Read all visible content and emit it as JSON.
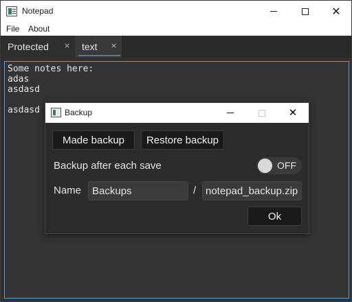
{
  "window": {
    "title": "Notepad"
  },
  "menu": {
    "file": "File",
    "about": "About"
  },
  "tabs": [
    {
      "label": "Protected",
      "close": "×"
    },
    {
      "label": "text",
      "close": "×"
    }
  ],
  "editor": {
    "content": "Some notes here:\nadas\nasdasd\n\nasdasd"
  },
  "dialog": {
    "title": "Backup",
    "made_backup": "Made backup",
    "restore_backup": "Restore backup",
    "backup_after_save_label": "Backup after each save",
    "toggle_state": "OFF",
    "name_label": "Name",
    "name_value": "Backups",
    "separator": "/",
    "file_value": "notepad_backup.zip",
    "ok": "Ok"
  },
  "icons": {
    "app": "notepad-app-icon",
    "minimize": "minimize-icon",
    "maximize": "maximize-icon",
    "close": "close-icon"
  },
  "colors": {
    "accent": "#2f86c5",
    "window_bg": "#303030",
    "dialog_bg": "#2b2b2b",
    "button_bg": "#1a1a1a"
  }
}
